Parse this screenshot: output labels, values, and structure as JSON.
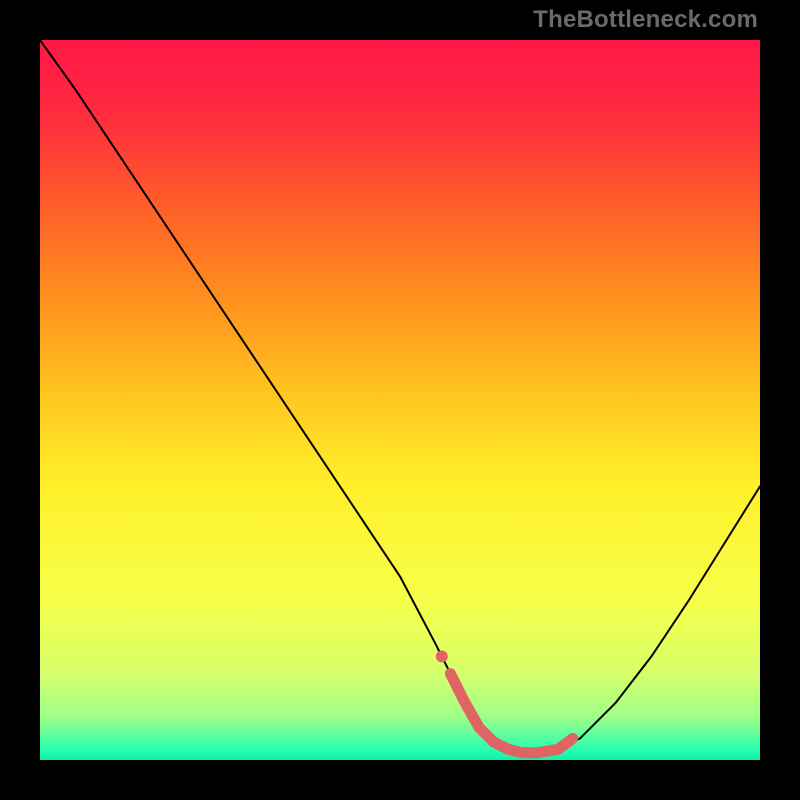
{
  "watermark": "TheBottleneck.com",
  "chart_data": {
    "type": "line",
    "title": "",
    "xlabel": "",
    "ylabel": "",
    "xlim": [
      0,
      100
    ],
    "ylim": [
      0,
      100
    ],
    "x": [
      0,
      5,
      10,
      15,
      20,
      25,
      30,
      35,
      40,
      45,
      50,
      55,
      57,
      59,
      61,
      63,
      65,
      67,
      69,
      72,
      75,
      80,
      85,
      90,
      95,
      100
    ],
    "values": [
      100,
      93,
      85.5,
      78,
      70.5,
      63,
      55.5,
      48,
      40.5,
      33,
      25.5,
      16,
      12,
      8,
      4.5,
      2.5,
      1.5,
      1.0,
      1.0,
      1.5,
      3,
      8,
      14.5,
      22,
      30,
      38
    ],
    "highlight_segment": {
      "x": [
        57,
        59,
        61,
        63,
        65,
        67,
        69,
        72,
        74
      ],
      "values": [
        12,
        8,
        4.5,
        2.5,
        1.5,
        1.0,
        1.0,
        1.5,
        3
      ]
    },
    "background_gradient_stops": [
      {
        "offset": 0.0,
        "color": "#ff1747"
      },
      {
        "offset": 0.1,
        "color": "#ff2a3f"
      },
      {
        "offset": 0.22,
        "color": "#ff5a2a"
      },
      {
        "offset": 0.35,
        "color": "#ff8c1e"
      },
      {
        "offset": 0.5,
        "color": "#ffc920"
      },
      {
        "offset": 0.62,
        "color": "#fff02a"
      },
      {
        "offset": 0.78,
        "color": "#f6ff4a"
      },
      {
        "offset": 0.88,
        "color": "#d5ff6a"
      },
      {
        "offset": 0.94,
        "color": "#9eff88"
      },
      {
        "offset": 0.985,
        "color": "#2bffb0"
      },
      {
        "offset": 1.0,
        "color": "#0df2a8"
      }
    ],
    "curve_color": "#000000",
    "highlight_color": "#e06464"
  }
}
